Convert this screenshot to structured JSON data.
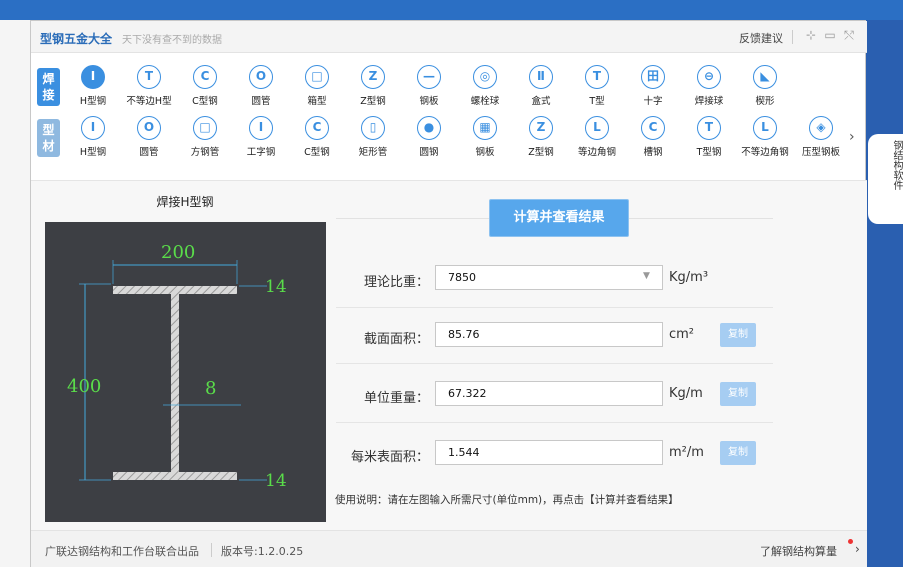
{
  "app": {
    "title": "型钢五金大全",
    "subtitle": "天下没有查不到的数据",
    "feedback": "反馈建议",
    "pin_icon": "⊹",
    "min_icon": "▭",
    "close_icon": "⤲"
  },
  "categories": {
    "weld": "焊接",
    "profile": "型材"
  },
  "weld_tools": [
    {
      "label": "H型钢",
      "glyph": "I",
      "selected": true
    },
    {
      "label": "不等边H型",
      "glyph": "T"
    },
    {
      "label": "C型钢",
      "glyph": "C"
    },
    {
      "label": "圆管",
      "glyph": "O"
    },
    {
      "label": "箱型",
      "glyph": "□"
    },
    {
      "label": "Z型钢",
      "glyph": "Z"
    },
    {
      "label": "钢板",
      "glyph": "—"
    },
    {
      "label": "螺栓球",
      "glyph": "◎"
    },
    {
      "label": "盒式",
      "glyph": "Ⅱ"
    },
    {
      "label": "T型",
      "glyph": "T"
    },
    {
      "label": "十字",
      "glyph": "田"
    },
    {
      "label": "焊接球",
      "glyph": "⊖"
    },
    {
      "label": "楔形",
      "glyph": "◣"
    }
  ],
  "profile_tools": [
    {
      "label": "H型钢",
      "glyph": "I"
    },
    {
      "label": "圆管",
      "glyph": "O"
    },
    {
      "label": "方钢管",
      "glyph": "□"
    },
    {
      "label": "工字钢",
      "glyph": "I"
    },
    {
      "label": "C型钢",
      "glyph": "C"
    },
    {
      "label": "矩形管",
      "glyph": "▯"
    },
    {
      "label": "圆钢",
      "glyph": "●"
    },
    {
      "label": "钢板",
      "glyph": "▦"
    },
    {
      "label": "Z型钢",
      "glyph": "Z"
    },
    {
      "label": "等边角钢",
      "glyph": "L"
    },
    {
      "label": "槽钢",
      "glyph": "C"
    },
    {
      "label": "T型钢",
      "glyph": "T"
    },
    {
      "label": "不等边角钢",
      "glyph": "L"
    },
    {
      "label": "压型钢板",
      "glyph": "◈"
    }
  ],
  "more_arrow": "›",
  "diagram": {
    "title": "焊接H型钢",
    "flange_width": "200",
    "height": "400",
    "web_thickness": "8",
    "top_flange_thickness": "14",
    "bottom_flange_thickness": "14"
  },
  "calc_button": "计算并查看结果",
  "fields": {
    "density": {
      "label": "理论比重：",
      "value": "7850",
      "unit": "Kg/m³"
    },
    "area": {
      "label": "截面面积：",
      "value": "85.76",
      "unit": "cm²",
      "copy": "复制"
    },
    "unit_weight": {
      "label": "单位重量：",
      "value": "67.322",
      "unit": "Kg/m",
      "copy": "复制"
    },
    "surface": {
      "label": "每米表面积：",
      "value": "1.544",
      "unit": "m²/m",
      "copy": "复制"
    }
  },
  "instructions": "使用说明：请在左图输入所需尺寸(单位mm)，再点击【计算并查看结果】",
  "status": {
    "left": "广联达钢结构和工作台联合出品",
    "version": "版本号:1.2.0.25",
    "right": "了解钢结构算量",
    "chev": "›"
  },
  "right_edge": "钢结构软件",
  "colors": {
    "accent": "#3a8fe0",
    "button": "#57a7ec",
    "diagram_bg": "#3d3f44",
    "dim_green": "#5adc4a"
  }
}
